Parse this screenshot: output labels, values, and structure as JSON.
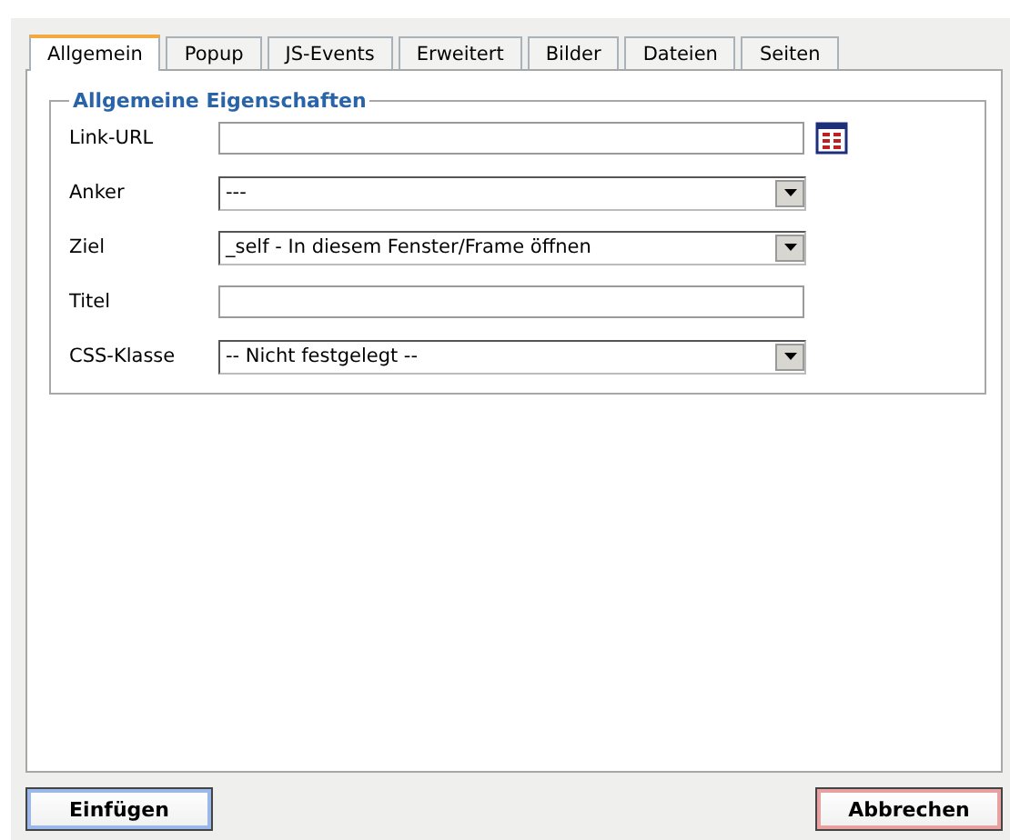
{
  "tabs": [
    {
      "label": "Allgemein",
      "selected": true
    },
    {
      "label": "Popup",
      "selected": false
    },
    {
      "label": "JS-Events",
      "selected": false
    },
    {
      "label": "Erweitert",
      "selected": false
    },
    {
      "label": "Bilder",
      "selected": false
    },
    {
      "label": "Dateien",
      "selected": false
    },
    {
      "label": "Seiten",
      "selected": false
    }
  ],
  "fieldset": {
    "legend": "Allgemeine Eigenschaften",
    "fields": [
      {
        "label": "Link-URL",
        "kind": "text",
        "browse": true
      },
      {
        "label": "Anker",
        "kind": "select",
        "value": "---"
      },
      {
        "label": "Ziel",
        "kind": "select",
        "value": "_self - In diesem Fenster/Frame öffnen"
      },
      {
        "label": "Titel",
        "kind": "text",
        "browse": false
      },
      {
        "label": "CSS-Klasse",
        "kind": "select",
        "value": "-- Nicht festgelegt --"
      }
    ]
  },
  "buttons": [
    {
      "label": "Einfügen",
      "kind": "insert"
    },
    {
      "label": "Abbrechen",
      "kind": "cancel"
    }
  ]
}
